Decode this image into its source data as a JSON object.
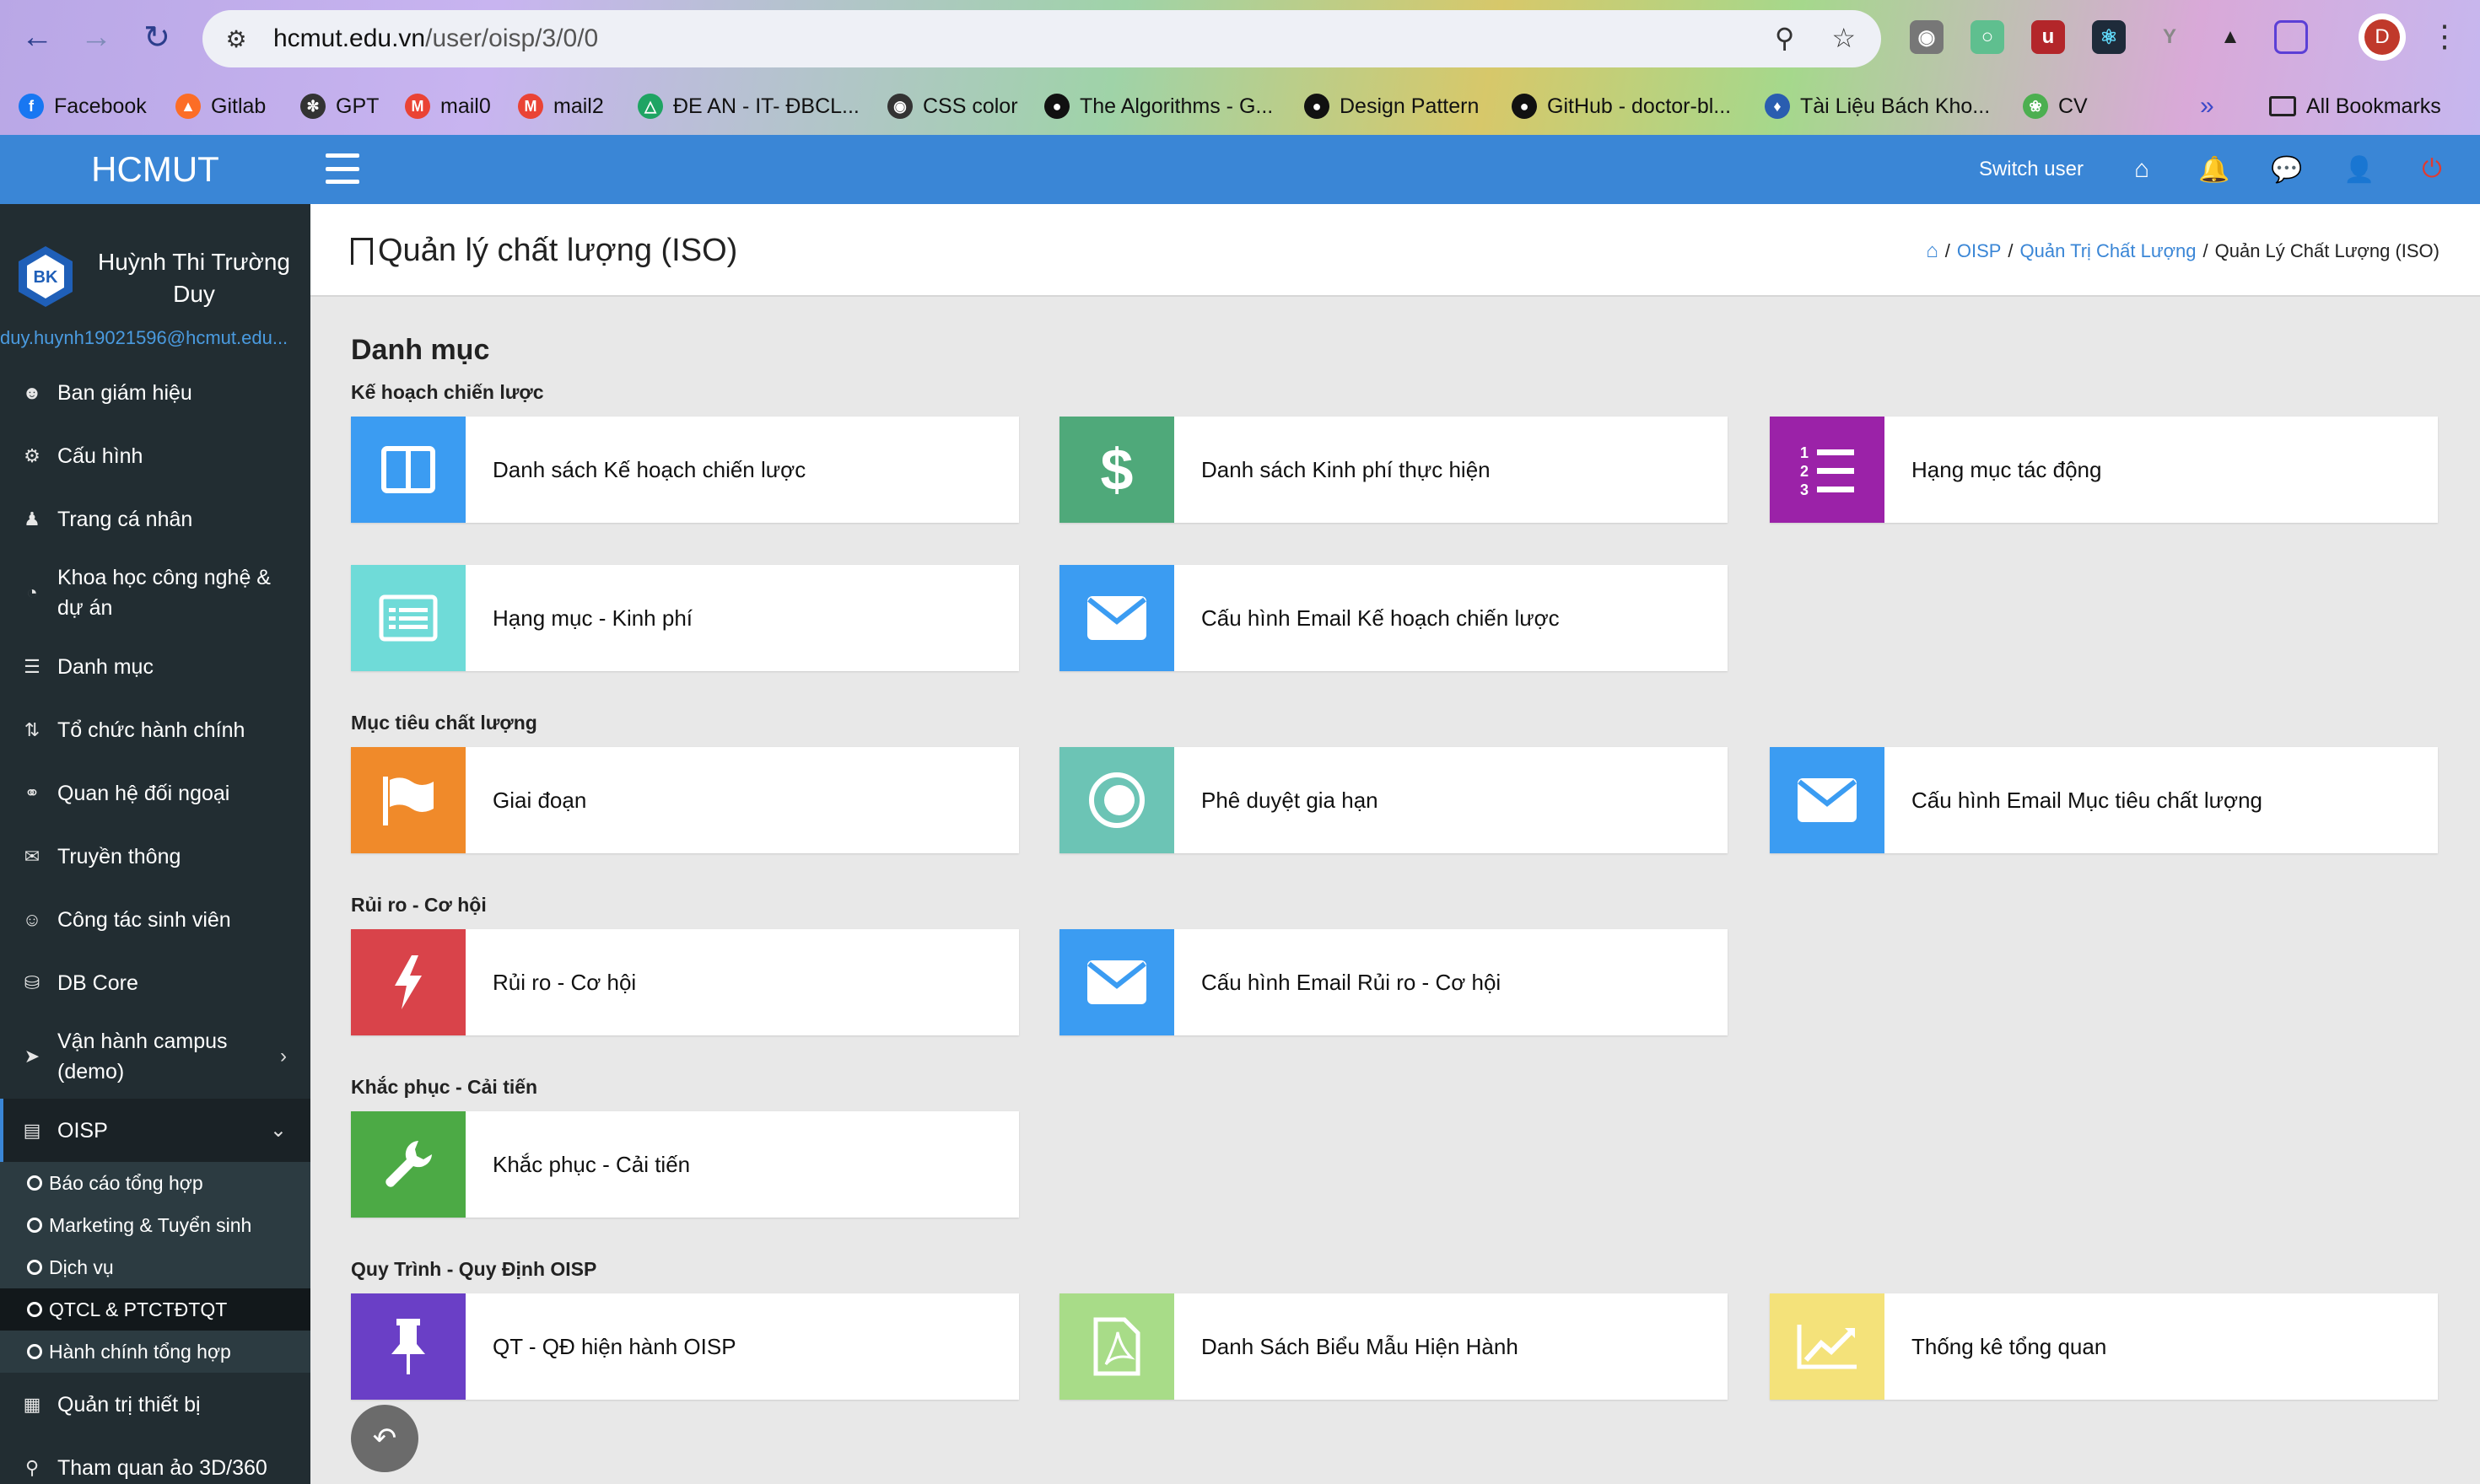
{
  "browser": {
    "url_host": "hcmut.edu.vn",
    "url_path": "/user/oisp/3/0/0",
    "profile_initial": "D",
    "bookmarks": [
      {
        "label": "Facebook",
        "icon": "facebook-icon",
        "color": "#1877f2"
      },
      {
        "label": "Gitlab",
        "icon": "gitlab-icon",
        "color": "#fc6d26"
      },
      {
        "label": "GPT",
        "icon": "openai-icon",
        "color": "#333333"
      },
      {
        "label": "mail0",
        "icon": "gmail-icon",
        "color": "#ea4335"
      },
      {
        "label": "mail2",
        "icon": "gmail-icon",
        "color": "#ea4335"
      },
      {
        "label": "ĐE AN - IT- ĐBCL...",
        "icon": "google-drive-icon",
        "color": "#1fa463"
      },
      {
        "label": "CSS color",
        "icon": "css-icon",
        "color": "#333333"
      },
      {
        "label": "The Algorithms - G...",
        "icon": "github-icon",
        "color": "#111111"
      },
      {
        "label": "Design Pattern",
        "icon": "github-icon",
        "color": "#111111"
      },
      {
        "label": "GitHub - doctor-bl...",
        "icon": "github-icon",
        "color": "#111111"
      },
      {
        "label": "Tài Liệu Bách Kho...",
        "icon": "bk-icon",
        "color": "#2a5db0"
      },
      {
        "label": "CV",
        "icon": "leaf-icon",
        "color": "#4caf50"
      }
    ],
    "all_bookmarks": "All Bookmarks"
  },
  "header": {
    "brand": "HCMUT",
    "switch_user": "Switch user"
  },
  "sidebar": {
    "user_name": "Huỳnh Thi Trường Duy",
    "user_email": "duy.huynh19021596@hcmut.edu...",
    "items": [
      {
        "label": "Ban giám hiệu",
        "icon": "users-icon"
      },
      {
        "label": "Cấu hình",
        "icon": "gear-icon"
      },
      {
        "label": "Trang cá nhân",
        "icon": "user-icon"
      },
      {
        "label": "Khoa học công nghệ & dự án",
        "icon": "dashboard-icon"
      },
      {
        "label": "Danh mục",
        "icon": "list-icon"
      },
      {
        "label": "Tổ chức hành chính",
        "icon": "sort-icon"
      },
      {
        "label": "Quan hệ đối ngoại",
        "icon": "handshake-icon"
      },
      {
        "label": "Truyền thông",
        "icon": "comments-icon"
      },
      {
        "label": "Công tác sinh viên",
        "icon": "user-circle-icon"
      },
      {
        "label": "DB Core",
        "icon": "database-icon"
      },
      {
        "label": "Vận hành campus (demo)",
        "icon": "rocket-icon"
      },
      {
        "label": "OISP",
        "icon": "list-alt-icon"
      }
    ],
    "oisp_sub": [
      "Báo cáo tổng hợp",
      "Marketing & Tuyển sinh",
      "Dịch vụ",
      "QTCL & PTCTĐTQT",
      "Hành chính tổng hợp"
    ],
    "after_items": [
      {
        "label": "Quản trị thiết bị",
        "icon": "cubes-icon"
      },
      {
        "label": "Tham quan ảo 3D/360",
        "icon": "map-marker-icon"
      }
    ]
  },
  "content": {
    "page_title": "Quản lý chất lượng (ISO)",
    "breadcrumb": {
      "sep": "/",
      "oisp": "OISP",
      "qtcl": "Quản Trị Chất Lượng",
      "current": "Quản Lý Chất Lượng (ISO)"
    },
    "section_title": "Danh mục",
    "groups": [
      {
        "label": "Kế hoạch chiến lược"
      },
      {
        "label": "Mục tiêu chất lượng"
      },
      {
        "label": "Rủi ro - Cơ hội"
      },
      {
        "label": "Khắc phục - Cải tiến"
      },
      {
        "label": "Quy Trình - Quy Định OISP"
      }
    ],
    "cards": [
      {
        "label": "Danh sách Kế hoạch chiến lược",
        "icon": "columns-icon",
        "color": "#3b9cf2"
      },
      {
        "label": "Danh sách Kinh phí thực hiện",
        "icon": "dollar-icon",
        "color": "#4fa97a"
      },
      {
        "label": "Hạng mục tác động",
        "icon": "ordered-list-icon",
        "color": "#9b22a8"
      },
      {
        "label": "Hạng mục - Kinh phí",
        "icon": "list-alt-icon",
        "color": "#6fdbd8"
      },
      {
        "label": "Cấu hình Email Kế hoạch chiến lược",
        "icon": "envelope-icon",
        "color": "#3b9cf2"
      },
      {
        "label": "Giai đoạn",
        "icon": "flag-icon",
        "color": "#f08a2a"
      },
      {
        "label": "Phê duyệt gia hạn",
        "icon": "circle-target-icon",
        "color": "#6cc4b5"
      },
      {
        "label": "Cấu hình Email Mục tiêu chất lượng",
        "icon": "envelope-icon",
        "color": "#3b9cf2"
      },
      {
        "label": "Rủi ro - Cơ hội",
        "icon": "bolt-icon",
        "color": "#d9434a"
      },
      {
        "label": "Cấu hình Email Rủi ro - Cơ hội",
        "icon": "envelope-icon",
        "color": "#3b9cf2"
      },
      {
        "label": "Khắc phục - Cải tiến",
        "icon": "wrench-icon",
        "color": "#4caa45"
      },
      {
        "label": "QT - QĐ hiện hành OISP",
        "icon": "thumbtack-icon",
        "color": "#6a3fc6"
      },
      {
        "label": "Danh Sách Biểu Mẫu Hiện Hành",
        "icon": "pdf-file-icon",
        "color": "#a8dc88"
      },
      {
        "label": "Thống kê tổng quan",
        "icon": "line-chart-icon",
        "color": "#f4e27a"
      }
    ]
  }
}
